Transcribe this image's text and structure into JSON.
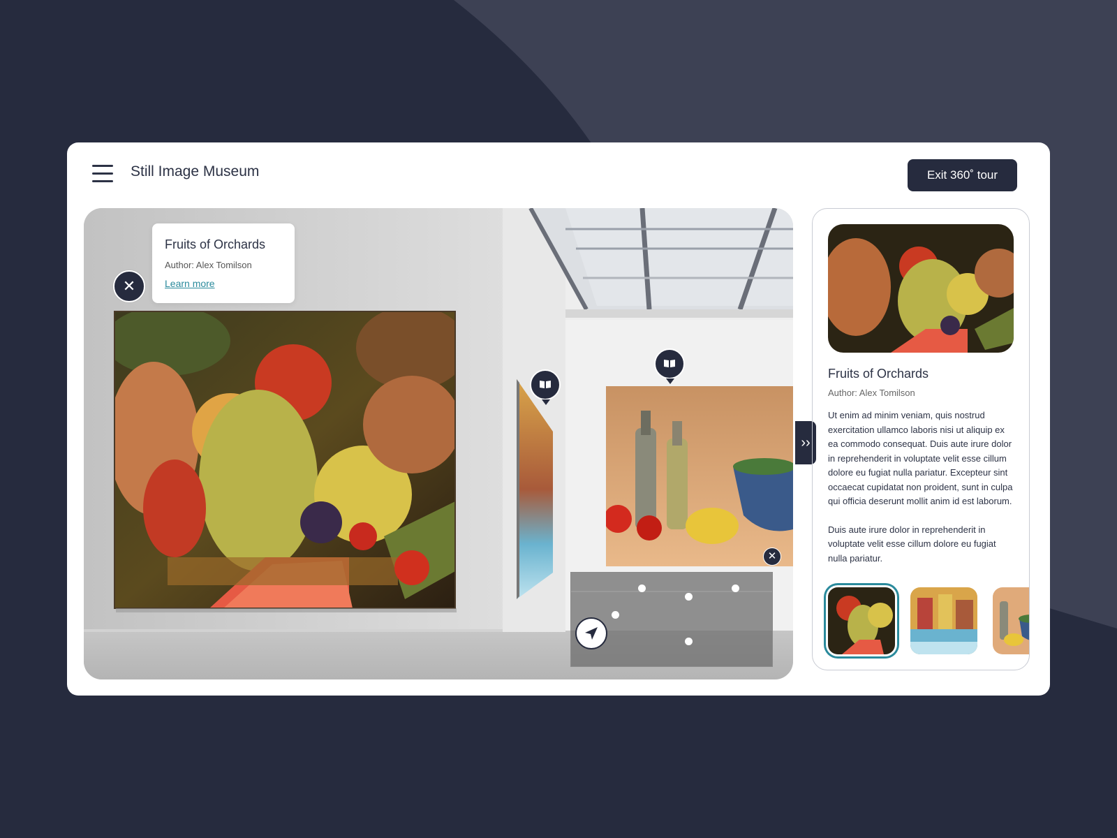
{
  "app": {
    "title": "Still Image Museum",
    "exit_label": "Exit 360˚ tour"
  },
  "popup": {
    "title": "Fruits of Orchards",
    "author": "Author: Alex Tomilson",
    "link": "Learn more",
    "close": "✕"
  },
  "tour": {
    "small_close": "✕",
    "collapse": "››"
  },
  "panel": {
    "title": "Fruits of Orchards",
    "author": "Author: Alex Tomilson",
    "paragraphs": [
      "Ut enim ad minim veniam, quis nostrud exercitation ullamco laboris nisi ut aliquip ex ea commodo consequat. Duis aute irure dolor in reprehenderit in voluptate velit esse cillum dolore eu fugiat nulla pariatur. Excepteur sint occaecat cupidatat non proident, sunt in culpa qui officia deserunt mollit anim id est laborum.",
      "Duis aute irure dolor in reprehenderit in voluptate velit esse cillum dolore eu fugiat nulla pariatur."
    ]
  },
  "icons": {
    "menu": "hamburger-menu-icon",
    "close": "close-icon",
    "book": "book-icon",
    "compass": "navigation-arrow-icon",
    "collapse": "chevron-double-right-icon"
  },
  "colors": {
    "background": "#262b3e",
    "accent": "#2a8a9c",
    "dark": "#262b3e"
  }
}
